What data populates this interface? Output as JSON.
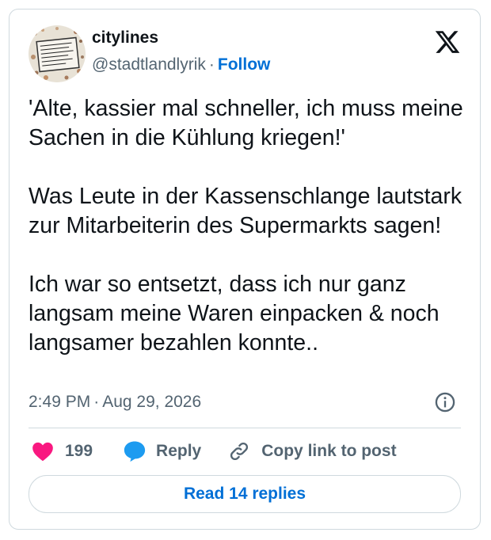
{
  "author": {
    "display_name": "citylines",
    "handle": "@stadtlandlyrik",
    "separator": "·",
    "follow_label": "Follow",
    "avatar_icon": "handwritten-note-avatar"
  },
  "tweet": {
    "paragraphs": [
      "'Alte, kassier mal schneller, ich muss meine Sachen in die Kühlung kriegen!'",
      "Was Leute in der Kassenschlange lautstark zur Mitarbeiterin des Supermarkts sagen!",
      "Ich war so entsetzt, dass ich nur ganz langsam meine Waren einpacken & noch langsamer bezahlen konnte.."
    ],
    "time": "2:49 PM",
    "date_separator": "·",
    "date": "Aug 29, 2026"
  },
  "actions": {
    "like_count": "199",
    "reply_label": "Reply",
    "copy_link_label": "Copy link to post",
    "read_replies_label": "Read 14 replies"
  },
  "colors": {
    "like": "#f91880",
    "reply": "#1d9bf0",
    "link": "#006fd6",
    "text": "#0f1419",
    "secondary": "#536471",
    "border": "#cfd9de"
  }
}
